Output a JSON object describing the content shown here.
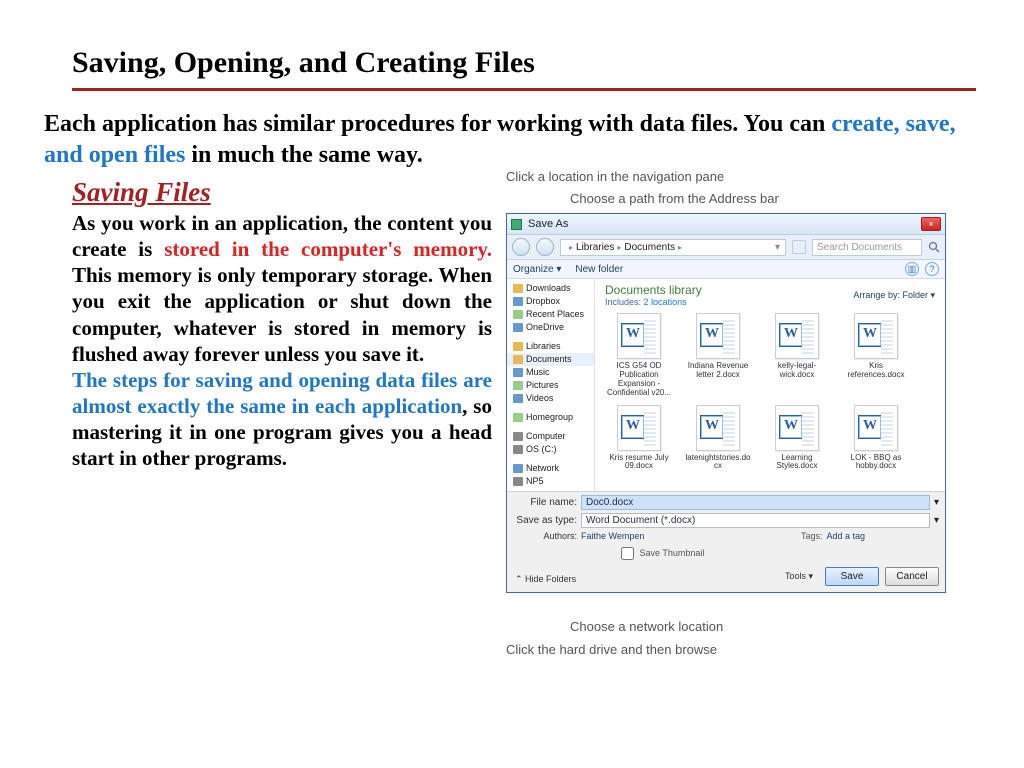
{
  "page": {
    "title": "Saving, Opening, and Creating Files",
    "lead_black_1": "Each application has similar procedures for working with data files. You can ",
    "lead_blue": "create, save, and open files",
    "lead_black_2": " in much the same way."
  },
  "section": {
    "heading": "Saving Files",
    "p1a": "As you work in an application, the content you create is ",
    "p1_red": "stored in the computer's memory.",
    "p1b": " This memory is only temporary storage. When you exit the application or shut down the computer, whatever is stored in memory is flushed away forever unless you save it.",
    "p2_blue": "The steps for saving and opening data files are almost exactly the same in each application",
    "p2_rest": ", so mastering it in one program gives you a head start in other programs."
  },
  "callouts": {
    "top1": "Click a location in the navigation pane",
    "top2": "Choose a path from the Address bar",
    "bot1": "Choose a network location",
    "bot2": "Click the hard drive and then browse"
  },
  "dialog": {
    "title": "Save As",
    "close": "×",
    "breadcrumb1": "Libraries",
    "breadcrumb2": "Documents",
    "search_placeholder": "Search Documents",
    "organize": "Organize ▾",
    "newfolder": "New folder",
    "lib_title": "Documents library",
    "lib_includes_label": "Includes:",
    "lib_includes_link": "2 locations",
    "arrange_label": "Arrange by:",
    "arrange_value": "Folder ▾",
    "nav": {
      "downloads": "Downloads",
      "dropbox": "Dropbox",
      "recent": "Recent Places",
      "onedrive": "OneDrive",
      "libraries": "Libraries",
      "documents": "Documents",
      "music": "Music",
      "pictures": "Pictures",
      "videos": "Videos",
      "homegroup": "Homegroup",
      "computer": "Computer",
      "os": "OS (C:)",
      "network": "Network",
      "np5": "NP5"
    },
    "files": [
      "ICS G54 OD Publication Expansion - Confidential v20...",
      "Indiana Revenue letter 2.docx",
      "kelly-legal-wick.docx",
      "Kris references.docx",
      "Kris resume July 09.docx",
      "latenightstories.docx",
      "Learning Styles.docx",
      "LOK - BBQ as hobby.docx"
    ],
    "filename_label": "File name:",
    "filename_value": "Doc0.docx",
    "savetype_label": "Save as type:",
    "savetype_value": "Word Document (*.docx)",
    "authors_label": "Authors:",
    "authors_value": "Faithe Wempen",
    "tags_label": "Tags:",
    "tags_value": "Add a tag",
    "save_thumb": "Save Thumbnail",
    "hide_folders": "Hide Folders",
    "tools": "Tools ▾",
    "save_btn": "Save",
    "cancel_btn": "Cancel"
  }
}
